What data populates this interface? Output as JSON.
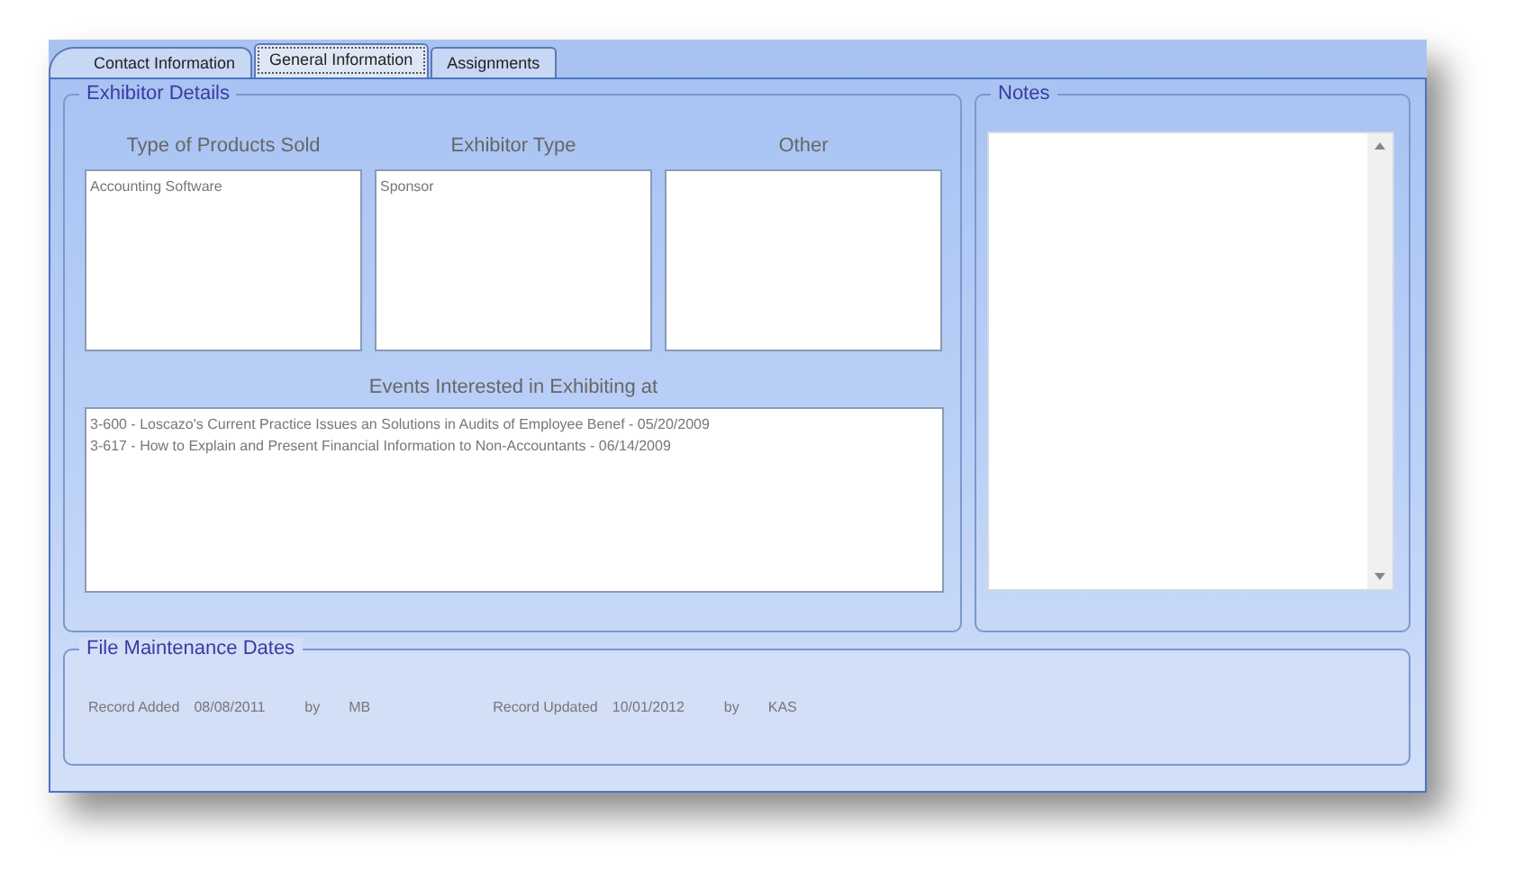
{
  "tabs": [
    {
      "label": "Contact Information",
      "selected": false
    },
    {
      "label": "General Information",
      "selected": true
    },
    {
      "label": "Assignments",
      "selected": false
    }
  ],
  "exhibitor_details": {
    "title": "Exhibitor Details",
    "lists": [
      {
        "label": "Type of Products Sold",
        "items": [
          "Accounting Software"
        ]
      },
      {
        "label": "Exhibitor Type",
        "items": [
          "Sponsor"
        ]
      },
      {
        "label": "Other"
      }
    ],
    "events": {
      "label": "Events Interested in Exhibiting at",
      "items": [
        "3-600 - Loscazo's Current Practice Issues an Solutions in Audits of Employee Benef - 05/20/2009",
        "3-617 - How to Explain and Present Financial Information to Non-Accountants - 06/14/2009"
      ]
    }
  },
  "notes": {
    "title": "Notes"
  },
  "file_maintenance": {
    "title": "File Maintenance Dates",
    "fields": [
      {
        "label": "Record Added",
        "date": "08/08/2011",
        "by_label": "by",
        "by": "MB"
      },
      {
        "label": "Record Updated",
        "date": "10/01/2012",
        "by_label": "by",
        "by": "KAS"
      }
    ]
  }
}
